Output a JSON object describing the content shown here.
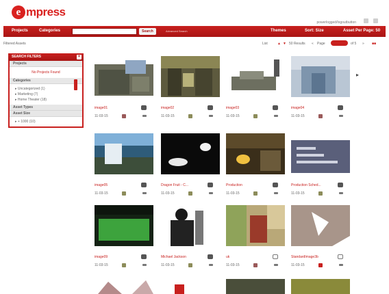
{
  "app": {
    "logo_mark": "e",
    "logo_text": "mpress",
    "user_line": "powerlogged/logoutbutton"
  },
  "toolbar": {
    "projects": "Projects",
    "categories": "Categories",
    "search_placeholder": "",
    "search_button": "Search",
    "advanced_search": "Advanced Search",
    "themes": "Themes",
    "sort": "Sort: Size",
    "assets_per_page": "Asset Per Page: 50"
  },
  "subbar": {
    "left": "Filtered Assets",
    "list_label": "List",
    "results": "50 Results",
    "page_label": "Page",
    "of_label": "of 5"
  },
  "sidebar": {
    "header": "SEARCH FILTERS",
    "projects_title": "Projects",
    "no_projects": "No Projects Found",
    "categories_title": "Categories",
    "categories": [
      "Uncategorized (1)",
      "Marketing (7)",
      "Home Theater (18)"
    ],
    "asset_types_title": "Asset Types",
    "asset_size_title": "Asset Size",
    "asset_size_items": [
      "+ 1000 (10)"
    ]
  },
  "cards": [
    {
      "title": "image01",
      "date": "11-03-15"
    },
    {
      "title": "image02",
      "date": "11-03-15"
    },
    {
      "title": "image03",
      "date": "11-03-15"
    },
    {
      "title": "image04",
      "date": "11-03-15"
    },
    {
      "title": "image05",
      "date": "11-03-15"
    },
    {
      "title": "Dragon Fruit - C...",
      "date": "11-03-15"
    },
    {
      "title": "Production",
      "date": "11-03-15"
    },
    {
      "title": "Production Sched...",
      "date": "11-03-15"
    },
    {
      "title": "image09",
      "date": "11-03-15"
    },
    {
      "title": "Michael Jackson",
      "date": "11-03-15"
    },
    {
      "title": "uk",
      "date": "11-03-15"
    },
    {
      "title": "StandardImage3b",
      "date": "11-03-15"
    }
  ],
  "colors": {
    "brand": "#d9211f",
    "bar": "#b81a18"
  }
}
